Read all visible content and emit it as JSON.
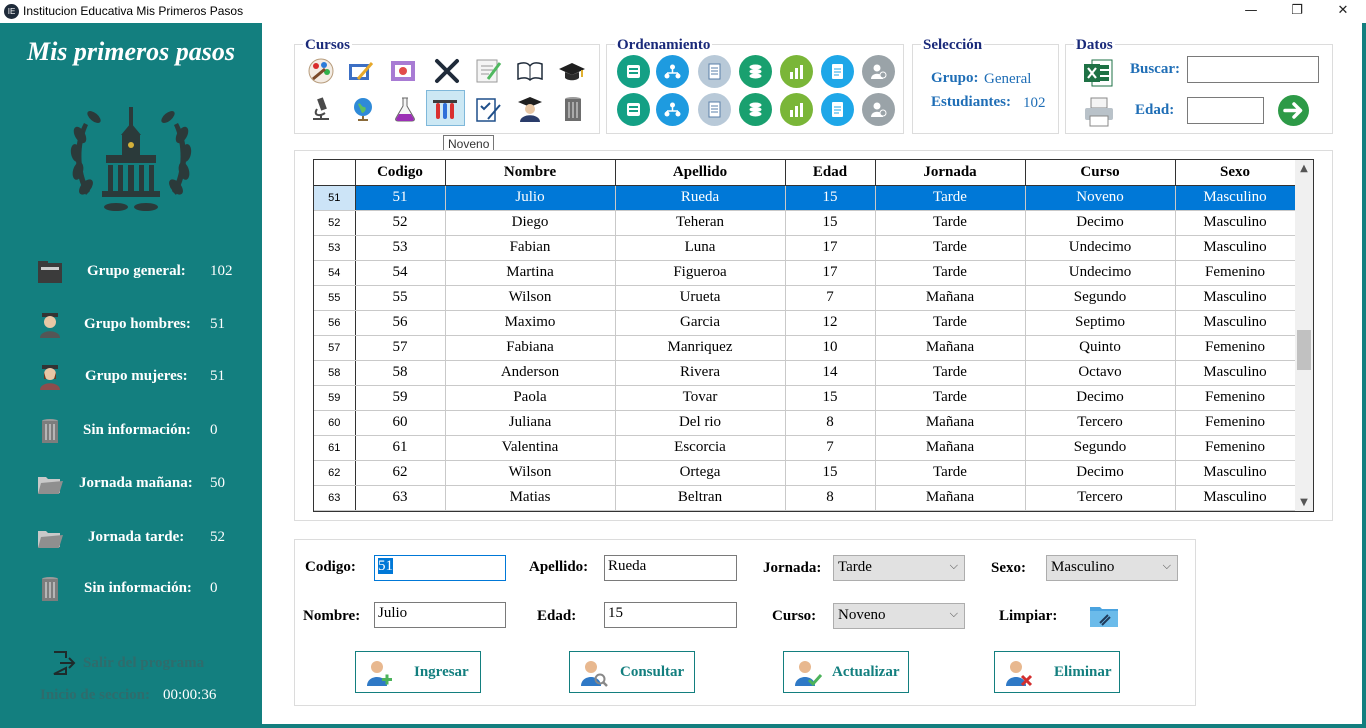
{
  "window": {
    "title": "Institucion Educativa Mis Primeros Pasos",
    "logo_text": "IE",
    "minimize": "—",
    "maximize": "❐",
    "close": "✕"
  },
  "sidebar": {
    "app_title": "Mis primeros pasos",
    "stats": [
      {
        "icon": "folder-dark-icon",
        "label": "Grupo general:",
        "value": "102"
      },
      {
        "icon": "male-student-icon",
        "label": "Grupo hombres:",
        "value": "51"
      },
      {
        "icon": "female-student-icon",
        "label": "Grupo mujeres:",
        "value": "51"
      },
      {
        "icon": "trash-can-icon",
        "label": "Sin información:",
        "value": "0"
      },
      {
        "icon": "open-folder-icon",
        "label": "Jornada mañana:",
        "value": "50"
      },
      {
        "icon": "open-folder-icon",
        "label": "Jornada tarde:",
        "value": "52"
      },
      {
        "icon": "trash-can-icon",
        "label": "Sin información:",
        "value": "0"
      }
    ],
    "exit_label": "Salir del programa",
    "session_label": "Inicio de seccion:",
    "session_time": "00:00:36"
  },
  "toolbar": {
    "cursos_title": "Cursos",
    "ordenamiento_title": "Ordenamiento",
    "seleccion_title": "Selección",
    "datos_title": "Datos",
    "tooltip": "Noveno",
    "grupo_label": "Grupo:",
    "grupo_value": "General",
    "estudiantes_label": "Estudiantes:",
    "estudiantes_value": "102",
    "buscar_label": "Buscar:",
    "buscar_value": "",
    "edad_label": "Edad:",
    "edad_value": "",
    "sort_colors": [
      "#14a085",
      "#1e9be0",
      "#b8c9d8",
      "#19a06f",
      "#7ab638",
      "#1ea7e8",
      "#9aa3a8"
    ]
  },
  "grid": {
    "columns": [
      "Codigo",
      "Nombre",
      "Apellido",
      "Edad",
      "Jornada",
      "Curso",
      "Sexo"
    ],
    "rows": [
      {
        "rh": "51",
        "cells": [
          "51",
          "Julio",
          "Rueda",
          "15",
          "Tarde",
          "Noveno",
          "Masculino"
        ]
      },
      {
        "rh": "52",
        "cells": [
          "52",
          "Diego",
          "Teheran",
          "15",
          "Tarde",
          "Decimo",
          "Masculino"
        ]
      },
      {
        "rh": "53",
        "cells": [
          "53",
          "Fabian",
          "Luna",
          "17",
          "Tarde",
          "Undecimo",
          "Masculino"
        ]
      },
      {
        "rh": "54",
        "cells": [
          "54",
          "Martina",
          "Figueroa",
          "17",
          "Tarde",
          "Undecimo",
          "Femenino"
        ]
      },
      {
        "rh": "55",
        "cells": [
          "55",
          "Wilson",
          "Urueta",
          "7",
          "Mañana",
          "Segundo",
          "Masculino"
        ]
      },
      {
        "rh": "56",
        "cells": [
          "56",
          "Maximo",
          "Garcia",
          "12",
          "Tarde",
          "Septimo",
          "Masculino"
        ]
      },
      {
        "rh": "57",
        "cells": [
          "57",
          "Fabiana",
          "Manriquez",
          "10",
          "Mañana",
          "Quinto",
          "Femenino"
        ]
      },
      {
        "rh": "58",
        "cells": [
          "58",
          "Anderson",
          "Rivera",
          "14",
          "Tarde",
          "Octavo",
          "Masculino"
        ]
      },
      {
        "rh": "59",
        "cells": [
          "59",
          "Paola",
          "Tovar",
          "15",
          "Tarde",
          "Decimo",
          "Femenino"
        ]
      },
      {
        "rh": "60",
        "cells": [
          "60",
          "Juliana",
          "Del rio",
          "8",
          "Mañana",
          "Tercero",
          "Femenino"
        ]
      },
      {
        "rh": "61",
        "cells": [
          "61",
          "Valentina",
          "Escorcia",
          "7",
          "Mañana",
          "Segundo",
          "Femenino"
        ]
      },
      {
        "rh": "62",
        "cells": [
          "62",
          "Wilson",
          "Ortega",
          "15",
          "Tarde",
          "Decimo",
          "Masculino"
        ]
      },
      {
        "rh": "63",
        "cells": [
          "63",
          "Matias",
          "Beltran",
          "8",
          "Mañana",
          "Tercero",
          "Masculino"
        ]
      }
    ],
    "selected_index": 0
  },
  "form": {
    "codigo_label": "Codigo:",
    "codigo_value": "51",
    "apellido_label": "Apellido:",
    "apellido_value": "Rueda",
    "jornada_label": "Jornada:",
    "jornada_value": "Tarde",
    "sexo_label": "Sexo:",
    "sexo_value": "Masculino",
    "nombre_label": "Nombre:",
    "nombre_value": "Julio",
    "edad_label": "Edad:",
    "edad_value": "15",
    "curso_label": "Curso:",
    "curso_value": "Noveno",
    "limpiar_label": "Limpiar:",
    "buttons": {
      "ingresar": "Ingresar",
      "consultar": "Consultar",
      "actualizar": "Actualizar",
      "eliminar": "Eliminar"
    },
    "chevron": "⌵"
  }
}
